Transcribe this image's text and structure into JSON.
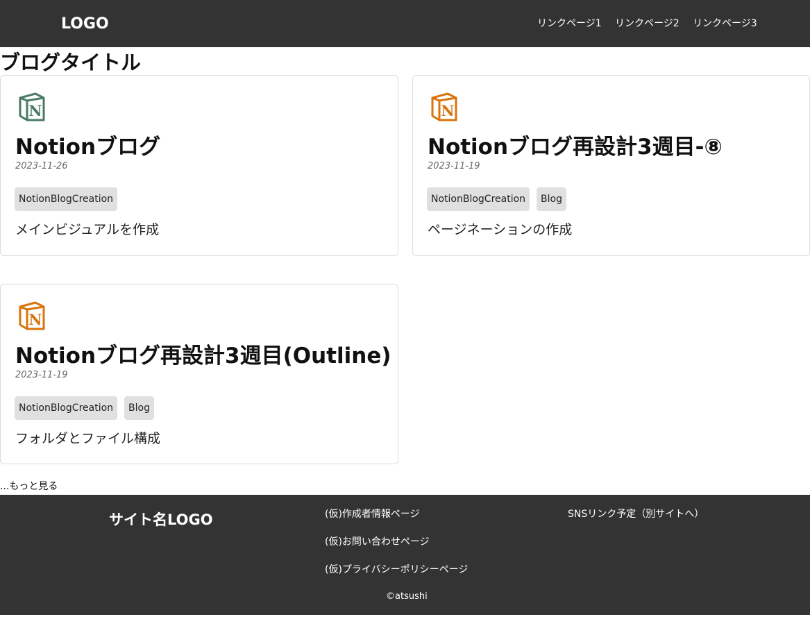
{
  "header": {
    "logo": "LOGO",
    "nav": [
      "リンクページ1",
      "リンクページ2",
      "リンクページ3"
    ],
    "background": "#333333"
  },
  "page_title": "ブログタイトル",
  "posts": [
    {
      "icon": "notion-icon",
      "icon_color": "#4a7a63",
      "title": "Notionブログ",
      "date": "2023-11-26",
      "tags": [
        "NotionBlogCreation"
      ],
      "description": "メインビジュアルを作成"
    },
    {
      "icon": "notion-icon",
      "icon_color": "#d9730d",
      "title": "Notionブログ再設計3週目-⑧",
      "date": "2023-11-19",
      "tags": [
        "NotionBlogCreation",
        "Blog"
      ],
      "description": "ページネーションの作成"
    },
    {
      "icon": "notion-icon",
      "icon_color": "#d9730d",
      "title": "Notionブログ再設計3週目(Outline)",
      "date": "2023-11-19",
      "tags": [
        "NotionBlogCreation",
        "Blog"
      ],
      "description": "フォルダとファイル構成"
    }
  ],
  "more_link": "...もっと見る",
  "footer": {
    "logo": "サイト名LOGO",
    "links": [
      "(仮)作成者情報ページ",
      "(仮)お問い合わせページ",
      "(仮)プライバシーポリシーページ"
    ],
    "sns": "SNSリンク予定（別サイトへ）",
    "copyright": "©atsushi"
  }
}
